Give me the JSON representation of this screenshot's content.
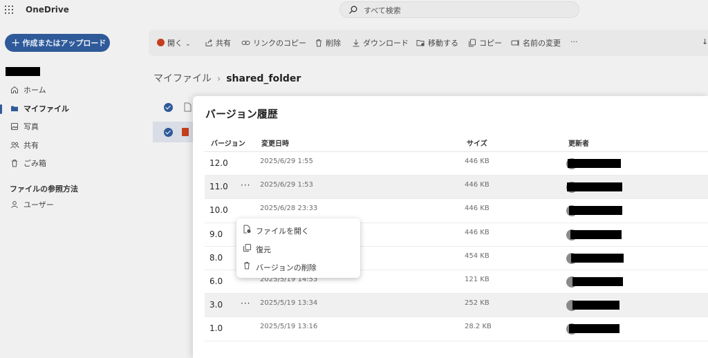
{
  "app": {
    "name": "OneDrive"
  },
  "search": {
    "placeholder": "すべて検索",
    "icon": "search-icon"
  },
  "sidebar": {
    "create_label": "作成またはアップロード",
    "items": [
      {
        "label": "ホーム",
        "icon": "home-icon"
      },
      {
        "label": "マイファイル",
        "icon": "folder-icon",
        "active": true
      },
      {
        "label": "写真",
        "icon": "photo-icon"
      },
      {
        "label": "共有",
        "icon": "people-icon"
      },
      {
        "label": "ごみ箱",
        "icon": "trash-icon"
      }
    ],
    "browse_heading": "ファイルの参照方法",
    "browse_items": [
      {
        "label": "ユーザー",
        "icon": "person-icon"
      }
    ]
  },
  "toolbar": {
    "open": "開く",
    "share": "共有",
    "copy_link": "リンクのコピー",
    "delete": "削除",
    "download": "ダウンロード",
    "move": "移動する",
    "copy": "コピー",
    "rename": "名前の変更",
    "more": "···"
  },
  "breadcrumb": {
    "root": "マイファイル",
    "current": "shared_folder"
  },
  "dialog": {
    "title": "バージョン履歴",
    "columns": {
      "version": "バージョン",
      "modified": "変更日時",
      "size": "サイズ",
      "modified_by": "更新者"
    },
    "rows": [
      {
        "version": "12.0",
        "date": "2025/6/29 1:55",
        "size": "446 KB",
        "more": ""
      },
      {
        "version": "11.0",
        "date": "2025/6/29 1:53",
        "size": "446 KB",
        "more": "···"
      },
      {
        "version": "10.0",
        "date": "2025/6/28 23:33",
        "size": "446 KB",
        "more": ""
      },
      {
        "version": "9.0",
        "date": "",
        "size": "446 KB",
        "more": ""
      },
      {
        "version": "8.0",
        "date": "",
        "size": "454 KB",
        "more": ""
      },
      {
        "version": "6.0",
        "date": "2025/5/19 14:53",
        "size": "121 KB",
        "more": ""
      },
      {
        "version": "3.0",
        "date": "2025/5/19 13:34",
        "size": "252 KB",
        "more": "···"
      },
      {
        "version": "1.0",
        "date": "2025/5/19 13:16",
        "size": "28.2 KB",
        "more": ""
      }
    ]
  },
  "context_menu": {
    "open_file": "ファイルを開く",
    "restore": "復元",
    "delete_version": "バージョンの削除"
  },
  "colors": {
    "accent": "#2f5a99",
    "powerpoint": "#c43e1c"
  }
}
